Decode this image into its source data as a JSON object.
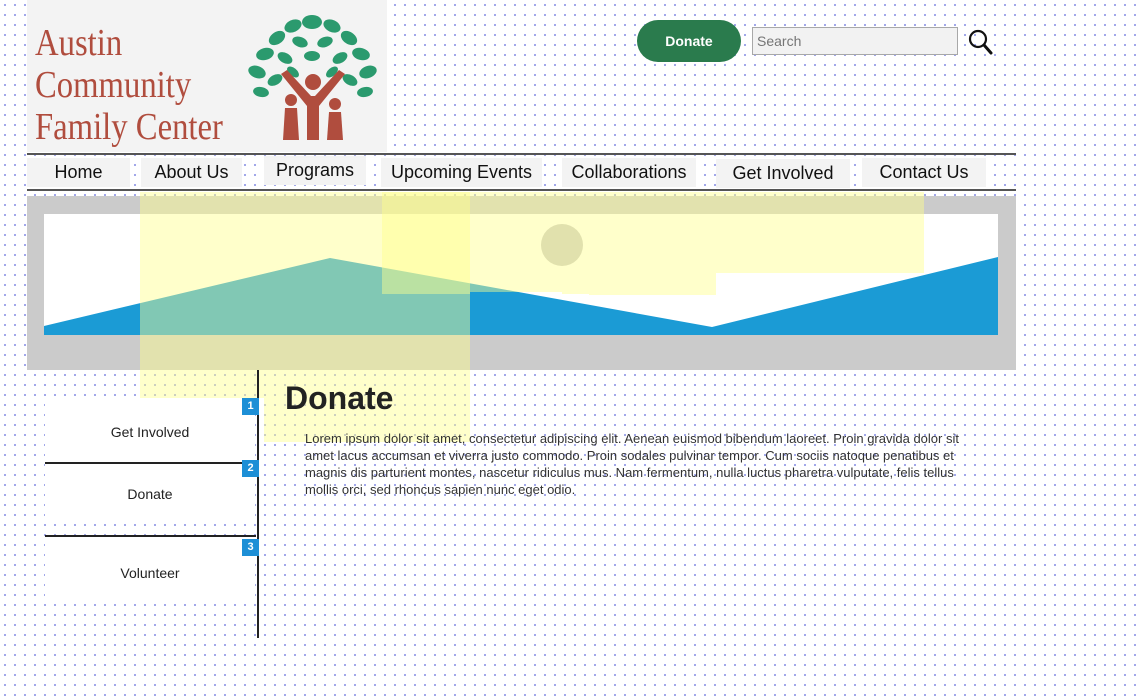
{
  "logo": {
    "lines": [
      "Austin",
      "Community",
      "Family Center"
    ],
    "icon": "tree-family-icon",
    "colors": {
      "text": "#b04d3e",
      "leaves": "#2b9a6e",
      "trunk": "#b04d3e"
    }
  },
  "header": {
    "donate_label": "Donate",
    "search_placeholder": "Search",
    "search_icon": "search-icon"
  },
  "nav": {
    "items": [
      {
        "label": "Home"
      },
      {
        "label": "About Us"
      },
      {
        "label": "Programs"
      },
      {
        "label": "Upcoming Events"
      },
      {
        "label": "Collaborations"
      },
      {
        "label": "Get Involved"
      },
      {
        "label": "Contact Us"
      }
    ]
  },
  "banner": {
    "image": "landscape-placeholder",
    "colors": {
      "mountain": "#1b9bd5",
      "sun": "#c8c8c8",
      "frame": "#cbcbcb"
    }
  },
  "sidebar": {
    "items": [
      {
        "label": "Get Involved",
        "badge": "1"
      },
      {
        "label": "Donate",
        "badge": "2"
      },
      {
        "label": "Volunteer",
        "badge": "3"
      }
    ]
  },
  "main": {
    "title": "Donate",
    "body": "Lorem ipsum dolor sit amet, consectetur adipiscing elit. Aenean euismod bibendum laoreet. Proin gravida dolor sit amet lacus accumsan et viverra justo commodo. Proin sodales pulvinar tempor. Cum sociis natoque penatibus et magnis dis parturient montes, nascetur ridiculus mus. Nam fermentum, nulla luctus pharetra vulputate, felis tellus mollis orci, sed rhoncus sapien nunc eget odio."
  },
  "colors": {
    "accent_green": "#2a7b4d",
    "badge_blue": "#1d8fd6",
    "highlight": "#ffff8c"
  }
}
